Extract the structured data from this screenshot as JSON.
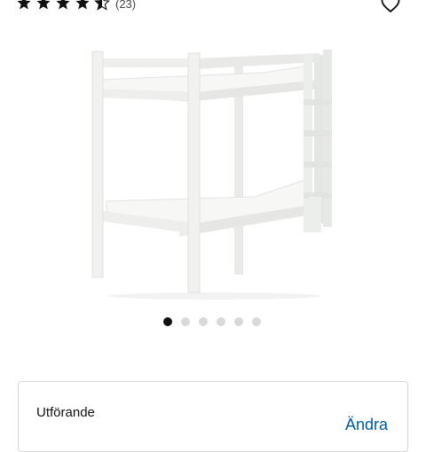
{
  "rating": {
    "stars_value": 4.5,
    "stars_max": 5,
    "review_count": "(23)"
  },
  "icons": {
    "wishlist": "heart-outline-icon",
    "star": "star-icon"
  },
  "product_image": {
    "subject": "white wooden bunk bed with ladder"
  },
  "carousel": {
    "total": 6,
    "active_index": 0
  },
  "variant": {
    "label": "Utförande",
    "change_link": "Ändra"
  },
  "colors": {
    "accent_link": "#0058a3",
    "star": "#111111",
    "dot_active": "#111111",
    "dot_inactive": "#d9d9d9"
  }
}
